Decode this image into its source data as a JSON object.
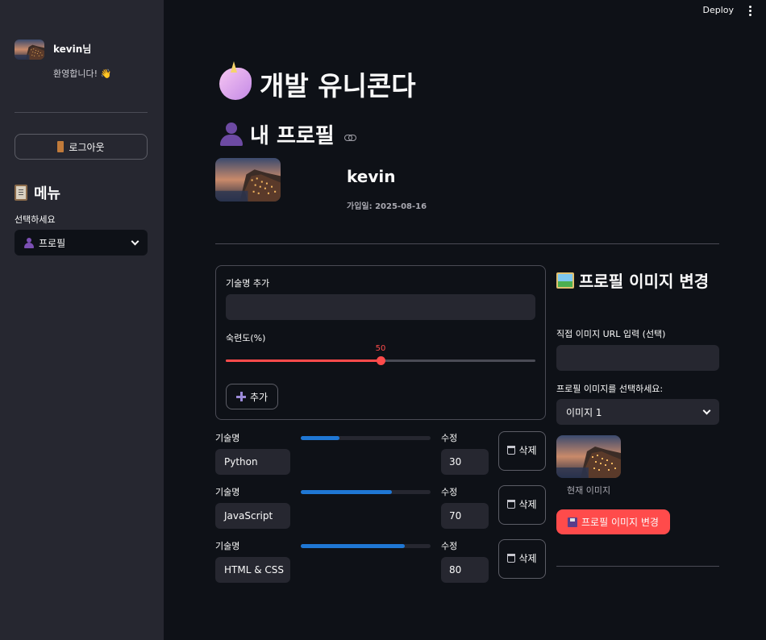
{
  "sidebar": {
    "user_name": "kevin님",
    "welcome": "환영합니다! 👋",
    "logout_label": "로그아웃",
    "menu_heading": "메뉴",
    "select_label": "선택하세요",
    "select_value": "프로필"
  },
  "header": {
    "deploy_label": "Deploy"
  },
  "main": {
    "app_title": "개발 유니콘다",
    "profile_heading": "내 프로필",
    "profile_name": "kevin",
    "join_date": "가입일: 2025-08-16",
    "skill_form": {
      "name_label": "기술명 추가",
      "name_value": "",
      "proficiency_label": "숙련도(%)",
      "proficiency_value": 50,
      "proficiency_display": "50",
      "add_label": "추가"
    },
    "skills": [
      {
        "label": "기술명",
        "name": "Python",
        "edit_label": "수정",
        "value": 30,
        "value_display": "30",
        "delete_label": "삭제"
      },
      {
        "label": "기술명",
        "name": "JavaScript",
        "edit_label": "수정",
        "value": 70,
        "value_display": "70",
        "delete_label": "삭제"
      },
      {
        "label": "기술명",
        "name": "HTML & CSS",
        "edit_label": "수정",
        "value": 80,
        "value_display": "80",
        "delete_label": "삭제"
      }
    ],
    "image_change": {
      "heading": "프로필 이미지 변경",
      "url_label": "직접 이미지 URL 입력 (선택)",
      "url_value": "",
      "select_label": "프로필 이미지를 선택하세요:",
      "select_value": "이미지 1",
      "current_caption": "현재 이미지",
      "change_button": "프로필 이미지 변경"
    }
  },
  "colors": {
    "background": "#0e1117",
    "sidebar": "#262730",
    "accent": "#ff4b4b",
    "progress": "#1f77d4"
  },
  "icons": {
    "logout": "door-icon",
    "menu": "clipboard-icon",
    "profile": "person-icon",
    "title": "unicorn-icon",
    "add": "plus-icon",
    "delete": "wastebasket-icon",
    "image": "framed-picture-icon",
    "save": "floppy-disk-icon"
  }
}
